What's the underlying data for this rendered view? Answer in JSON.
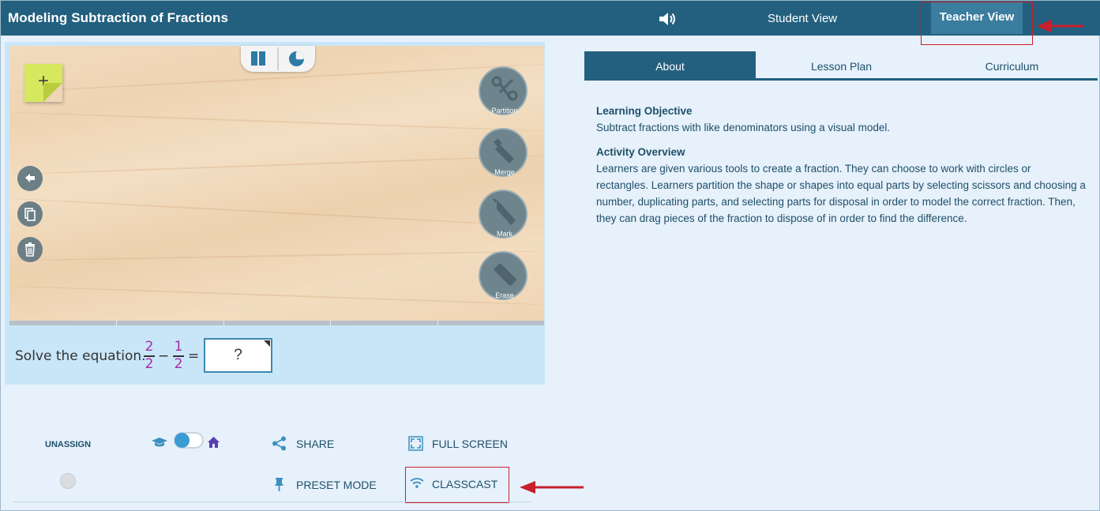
{
  "header": {
    "title": "Modeling Subtraction of Fractions",
    "student_view": "Student View",
    "teacher_view": "Teacher View",
    "speaker_icon": "speaker-icon"
  },
  "workspace": {
    "mode_toggle": [
      "bars-icon",
      "pie-chart-icon"
    ],
    "sticky_note": "+",
    "side_tools": [
      "undo-icon",
      "copy-icon",
      "trash-icon"
    ],
    "tools": [
      {
        "label": "Partition",
        "icon": "scissors-icon"
      },
      {
        "label": "Merge",
        "icon": "glue-icon"
      },
      {
        "label": "Mark",
        "icon": "crayon-icon"
      },
      {
        "label": "Erase",
        "icon": "eraser-icon"
      }
    ]
  },
  "equation": {
    "prompt": "Solve the equation.",
    "fraction1": {
      "numerator": "2",
      "denominator": "2"
    },
    "operator": "−",
    "fraction2": {
      "numerator": "1",
      "denominator": "2"
    },
    "equals": "=",
    "answer_placeholder": "?"
  },
  "controls": {
    "unassign": "UNASSIGN",
    "share": "SHARE",
    "full_screen": "FULL SCREEN",
    "preset_mode": "PRESET MODE",
    "classcast": "CLASSCAST"
  },
  "tabs": [
    "About",
    "Lesson Plan",
    "Curriculum"
  ],
  "active_tab": "About",
  "about": {
    "objective_heading": "Learning Objective",
    "objective_text": "Subtract fractions with like denominators using a visual model.",
    "overview_heading": "Activity Overview",
    "overview_text": "Learners are given various tools to create a fraction. They can choose to work with circles or rectangles. Learners partition the shape or shapes into equal parts by selecting scissors and choosing a number, duplicating parts, and selecting parts for disposal in order to model the correct fraction. Then, they can drag pieces of the fraction to dispose of in order to find the difference."
  },
  "colors": {
    "header_bg": "#23607f",
    "highlight_box": "#c8202c",
    "fraction_color": "#a42aa7",
    "accent": "#3c9bd3"
  }
}
